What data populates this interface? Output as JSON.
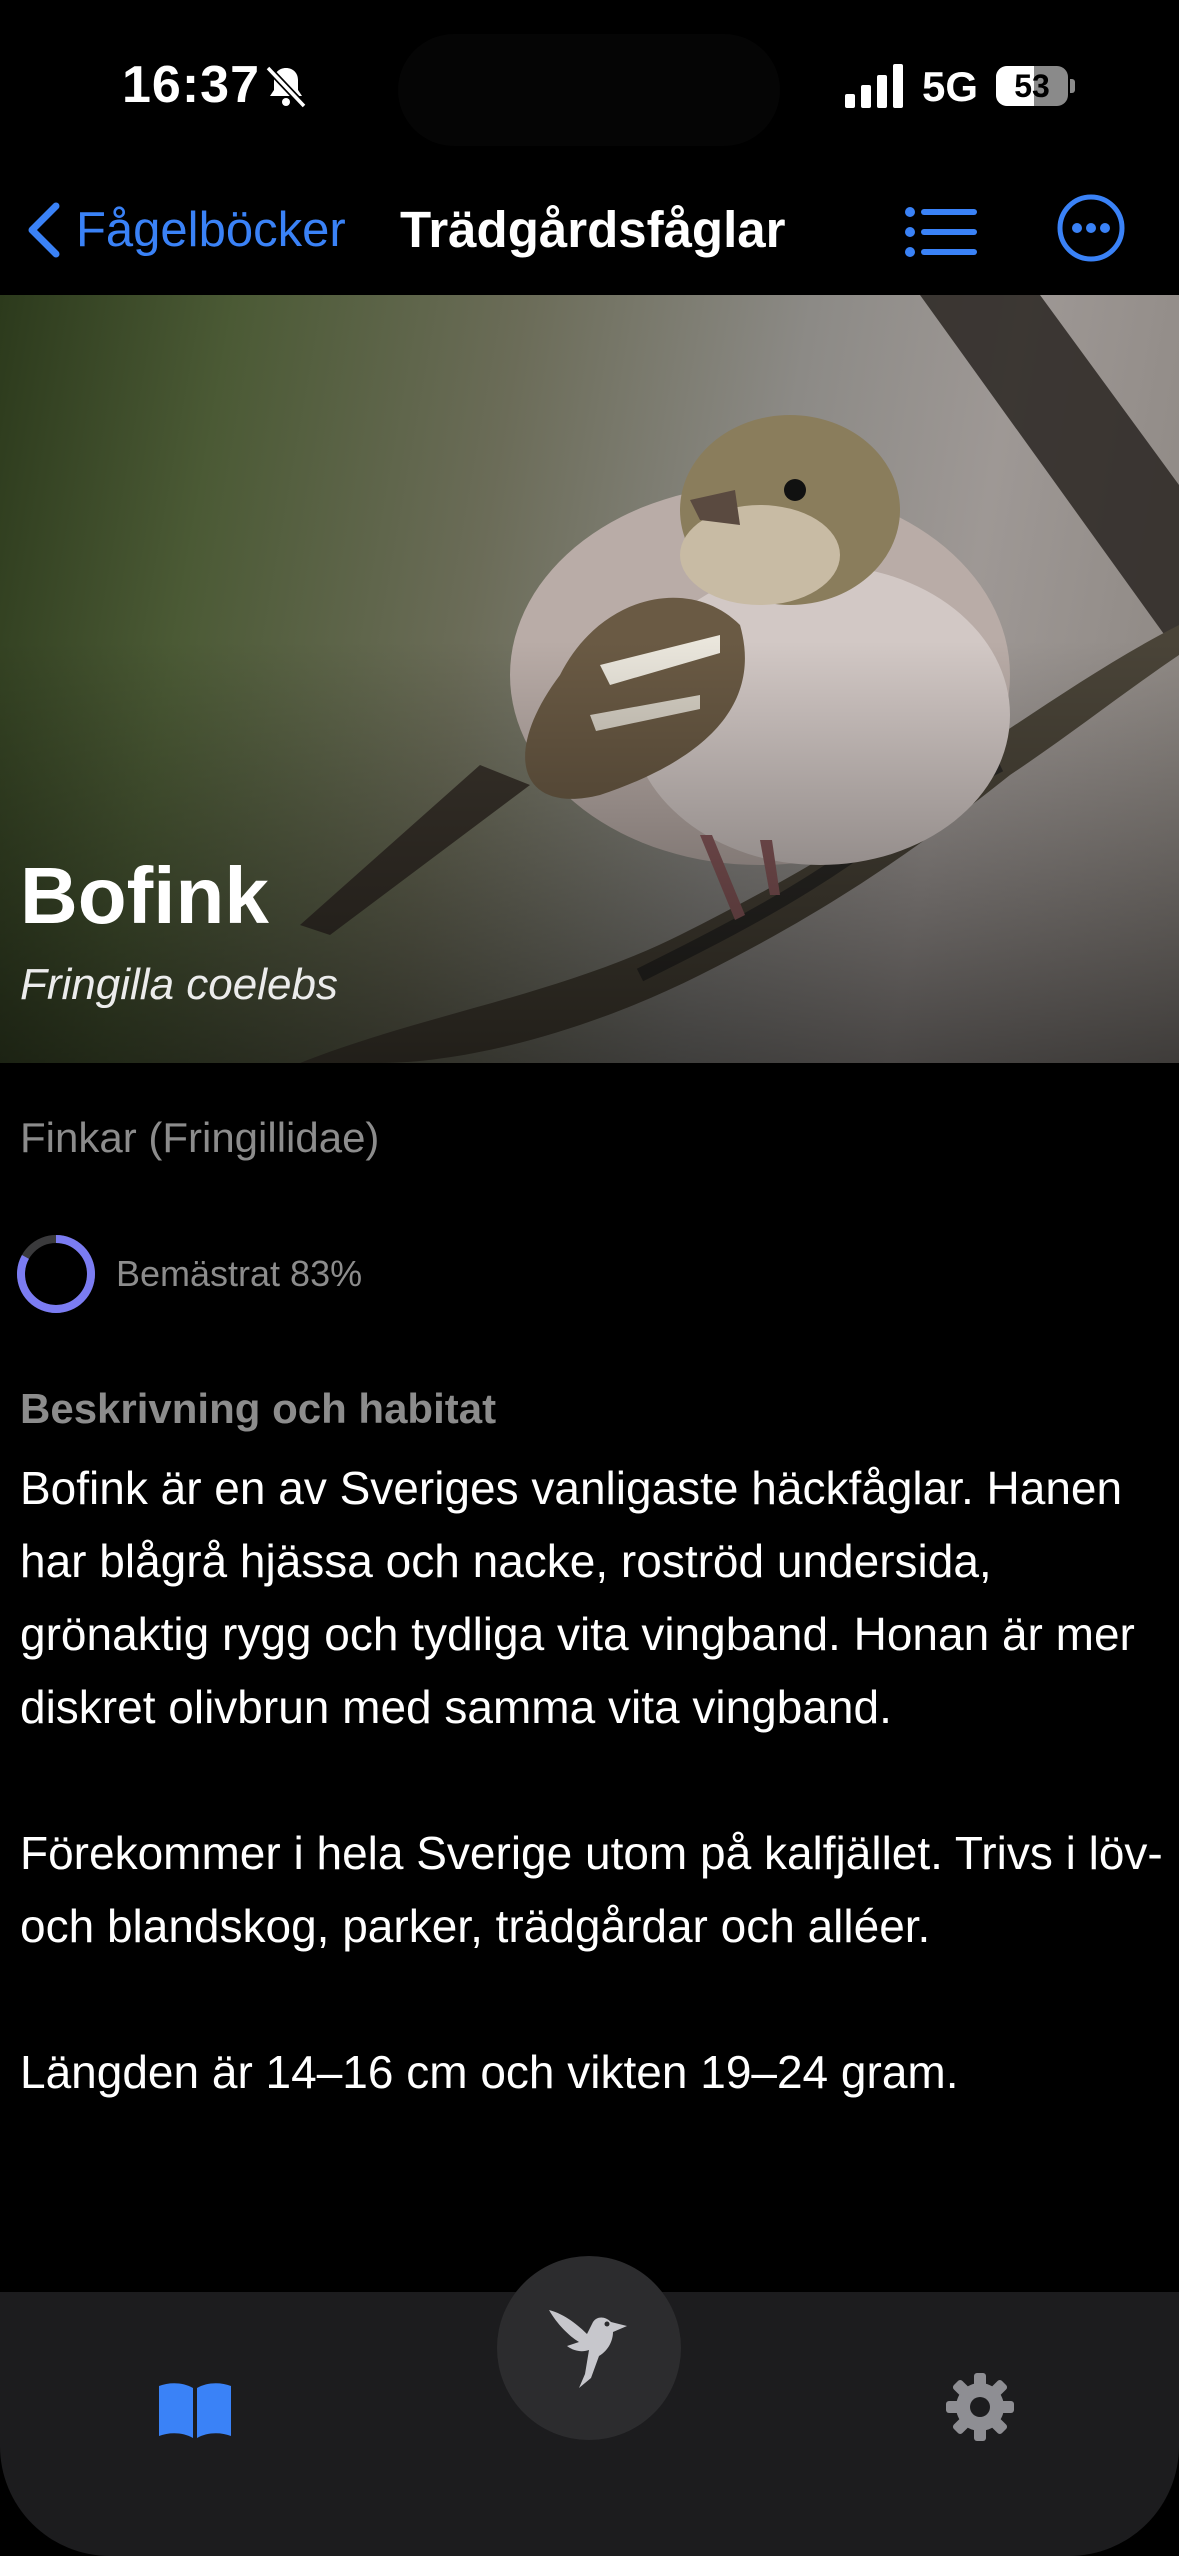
{
  "status_bar": {
    "time": "16:37",
    "network": "5G",
    "battery": "53",
    "battery_level": 0.53
  },
  "nav": {
    "back_label": "Fågelböcker",
    "title": "Trädgårdsfåglar"
  },
  "hero": {
    "name": "Bofink",
    "latin": "Fringilla coelebs"
  },
  "family": "Finkar (Fringillidae)",
  "mastery": {
    "label": "Bemästrat 83%",
    "fraction": 0.83
  },
  "description": {
    "title": "Beskrivning och habitat",
    "paragraphs": [
      "Bofink är en av Sveriges vanligaste häckfåglar. Hanen har blågrå hjässa och nacke, roströd undersida, grönaktig rygg och tydliga vita vingband. Honan är mer diskret olivbrun med samma vita vingband.",
      "Förekommer i hela Sverige utom på kalfjället. Trivs i löv- och blandskog, parker, trädgårdar och alléer.",
      "Längden är 14–16 cm och vikten 19–24 gram."
    ]
  },
  "colors": {
    "accent": "#3a82f7",
    "ring": "#7b7cf2"
  },
  "icons": [
    "bell-slash-icon",
    "signal-icon",
    "chevron-left-icon",
    "list-icon",
    "more-icon",
    "book-icon",
    "gear-icon",
    "bird-icon"
  ]
}
